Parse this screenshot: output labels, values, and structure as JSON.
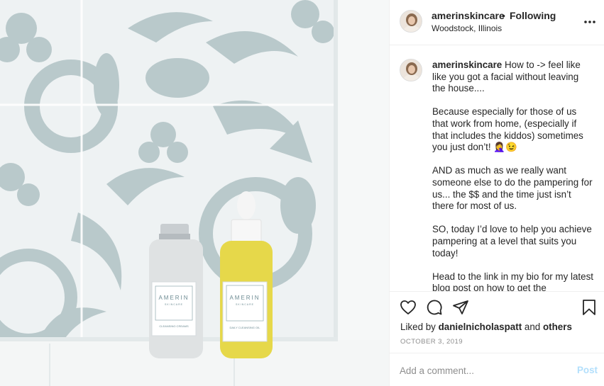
{
  "header": {
    "username": "amerinskincare",
    "separator": "•",
    "follow_label": "Following",
    "location": "Woodstock, Illinois"
  },
  "caption": {
    "username": "amerinskincare",
    "paragraphs": [
      "How to -> feel like like you got a facial without leaving the house....",
      "Because especially for those of us that work from home, (especially if that includes the kiddos) sometimes you just don’t! 🤦‍♀️😉",
      "AND as much as we really want someone else to do the pampering for us... the $$ and the time just isn’t there for most of us.",
      "SO, today I’d love to help you achieve pampering at a level that suits you today!",
      "Head to the link in my bio for my latest blog post on how to get the"
    ]
  },
  "photo": {
    "bottle_left": {
      "brand": "AMERIN",
      "sub": "SKINCARE",
      "product": "CLEANSING CREAMS"
    },
    "bottle_right": {
      "brand": "AMERIN",
      "sub": "SKINCARE",
      "product": "DAILY CLEANSING OIL"
    }
  },
  "actions": {
    "liked_by_prefix": "Liked by ",
    "liked_by_user": "danielnicholaspatt",
    "liked_by_and": " and ",
    "liked_by_others": "others",
    "date": "OCTOBER 3, 2019"
  },
  "comment": {
    "placeholder": "Add a comment...",
    "post_label": "Post"
  },
  "icons": {
    "like": "heart-icon",
    "comment": "comment-bubble-icon",
    "share": "paper-plane-icon",
    "save": "bookmark-icon",
    "more": "ellipsis-icon"
  },
  "colors": {
    "tile_pattern": "#b9c9cb",
    "tile_bg": "#eef2f3",
    "post_button_disabled": "#b2dffc",
    "muted_text": "#8e8e8e"
  }
}
